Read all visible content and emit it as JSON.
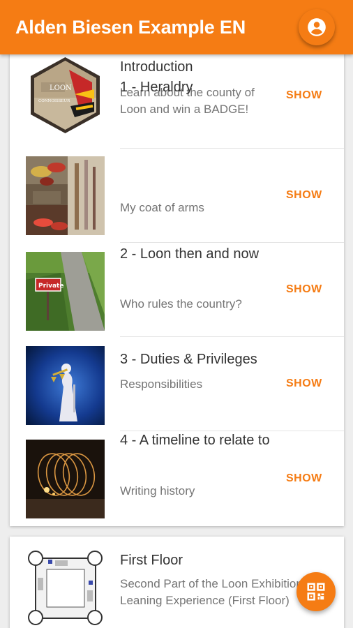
{
  "appbar": {
    "title": "Alden Biesen Example EN",
    "account_icon": "account-circle-icon"
  },
  "colors": {
    "accent": "#f57c14",
    "title_text": "#333333",
    "subtitle_text": "#757575"
  },
  "card1": {
    "items": [
      {
        "title": "Introduction",
        "subtitle": "Learn about the county of Loon and win a BADGE!",
        "action": "SHOW",
        "thumb_text_1": "LOON",
        "thumb_text_2": "CONNOISSEUR"
      },
      {
        "title": "1 - Heraldry",
        "subtitle": "My coat of arms",
        "action": "SHOW"
      },
      {
        "title": "2 - Loon then and now",
        "subtitle": "Who rules the country?",
        "action": "SHOW",
        "thumb_sign": "Private"
      },
      {
        "title": "3 - Duties & Privileges",
        "subtitle": "Responsibilities",
        "action": "SHOW"
      },
      {
        "title": "4 - A timeline to relate to",
        "subtitle": "Writing history",
        "action": "SHOW"
      }
    ]
  },
  "card2": {
    "title": "First Floor",
    "subtitle": "Second Part of the Loon Exhibition Leaning Experience (First Floor)"
  },
  "fab": {
    "icon": "qr-code-icon"
  }
}
